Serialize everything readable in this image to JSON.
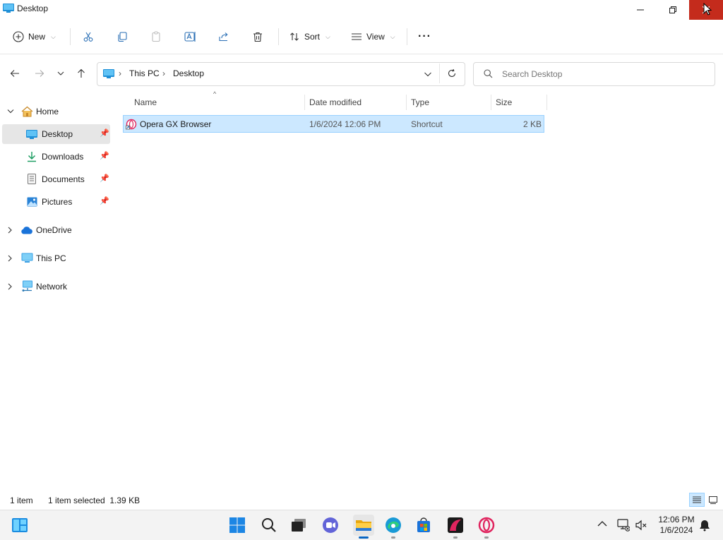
{
  "window": {
    "title": "Desktop"
  },
  "toolbar": {
    "new_label": "New",
    "sort_label": "Sort",
    "view_label": "View",
    "more_label": "···"
  },
  "address": {
    "segments": [
      "This PC",
      "Desktop"
    ]
  },
  "search": {
    "placeholder": "Search Desktop"
  },
  "nav": {
    "home": "Home",
    "quick_access": [
      {
        "label": "Desktop",
        "icon": "desktop-icon",
        "selected": true
      },
      {
        "label": "Downloads",
        "icon": "downloads-icon"
      },
      {
        "label": "Documents",
        "icon": "documents-icon"
      },
      {
        "label": "Pictures",
        "icon": "pictures-icon"
      }
    ],
    "onedrive": "OneDrive",
    "this_pc": "This PC",
    "network": "Network"
  },
  "columns": {
    "name": "Name",
    "date": "Date modified",
    "type": "Type",
    "size": "Size"
  },
  "files": [
    {
      "name": "Opera GX Browser",
      "date": "1/6/2024 12:06 PM",
      "type": "Shortcut",
      "size": "2 KB",
      "selected": true
    }
  ],
  "status": {
    "count": "1 item",
    "selection": "1 item selected  1.39 KB"
  },
  "taskbar": {
    "apps": [
      "start",
      "search",
      "task-view",
      "chat",
      "file-explorer",
      "edge",
      "store",
      "opera-gx-app",
      "opera"
    ],
    "clock": {
      "time": "12:06 PM",
      "date": "1/6/2024"
    }
  },
  "colors": {
    "accent": "#0a66c2",
    "selection": "#cce8ff",
    "close_hover": "#c42b1c",
    "opera": "#e0245e"
  }
}
